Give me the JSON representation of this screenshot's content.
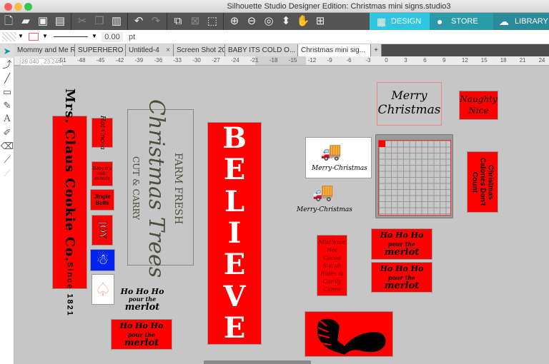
{
  "window": {
    "title": "Silhouette Studio Designer Edition: Christmas mini signs.studio3"
  },
  "toolbar": {
    "icons": [
      "new-file-icon",
      "open-folder-icon",
      "save-icon",
      "print-icon",
      "cut-icon",
      "copy-icon",
      "paste-icon",
      "undo-icon",
      "redo-icon",
      "group-icon",
      "ungroup-icon",
      "compound-icon",
      "zoom-in-icon",
      "zoom-out-icon",
      "zoom-select-icon",
      "fit-page-icon",
      "pan-hand-icon",
      "add-page-icon"
    ]
  },
  "nav": {
    "design": "DESIGN",
    "store": "STORE",
    "library": "LIBRARY",
    "colors": {
      "design": "#2ec6e0",
      "store": "#2b9aa8",
      "library": "#2b8a99"
    }
  },
  "props": {
    "line_width": "0.00",
    "unit": "pt",
    "line_color": "#f06060"
  },
  "tabs": [
    {
      "label": "Mommy and Me Re..."
    },
    {
      "label": "SUPERHERO FONT..."
    },
    {
      "label": "Untitled-4"
    },
    {
      "label": "Screen Shot 2017-..."
    },
    {
      "label": "BABY ITS COLD O..."
    },
    {
      "label": "Christmas mini sig...",
      "active": true
    }
  ],
  "tab_close": "×",
  "tab_add": "+",
  "ruler": {
    "coords": "29.040 , 23.244",
    "ticks": [
      "-51",
      "-48",
      "-45",
      "-42",
      "-39",
      "-36",
      "-33",
      "-30",
      "-27",
      "-24",
      "-21",
      "-18",
      "-15",
      "-12",
      "-9",
      "-6",
      "-3",
      "0",
      "3",
      "6",
      "9",
      "12",
      "15",
      "18",
      "21",
      "24",
      "27"
    ]
  },
  "designs": {
    "mrs_claus": "Mrs. Claus Cookie Co.",
    "since": "Since 1821",
    "hot_cocoa": "Hot Cocoa",
    "baby": "Baby it's cold outside",
    "jingle": "Jingle Bells",
    "joy": "JOY",
    "farm_fresh": "FARM FRESH",
    "christmas_trees": "Christmas Trees",
    "cut_carry": "CUT & CARRY",
    "believe": [
      "B",
      "E",
      "L",
      "I",
      "E",
      "V",
      "E"
    ],
    "hoho": "Ho Ho Ho",
    "pour": "pour the",
    "merlot": "merlot",
    "merry": "Merry",
    "christmas": "Christmas",
    "merry_christmas": "Merry-Christmas",
    "naughty": "Naughty",
    "nice": "Nice",
    "calories": "Christmas Calories Don't Count",
    "mistletoe": "Mistletoe Hot Cocoa Sleigh Rides & Candy Canes",
    "accent": "#ff0000"
  }
}
